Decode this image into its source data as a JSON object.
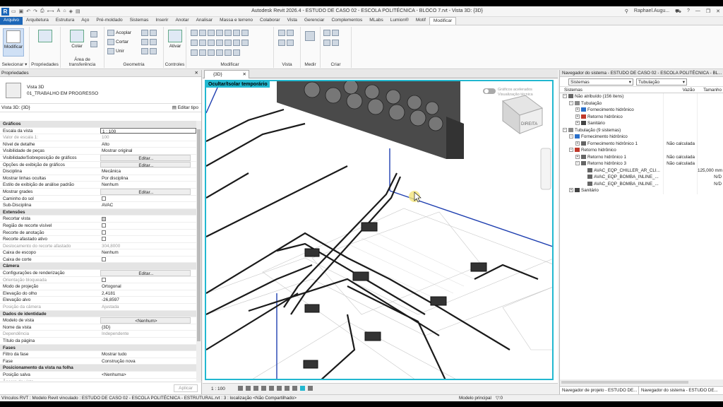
{
  "app": {
    "logo": "R",
    "window_title": "Autodesk Revit 2026.4 - ESTUDO DE CASO 02 - ESCOLA POLITÉCNICA - BLOCO 7.rvt - Vista 3D: {3D}",
    "user": "Raphael.Augu...",
    "help": "?"
  },
  "tabs": [
    "Arquivo",
    "Arquitetura",
    "Estrutura",
    "Aço",
    "Pré-moldado",
    "Sistemas",
    "Inserir",
    "Anotar",
    "Analisar",
    "Massa e terreno",
    "Colaborar",
    "Vista",
    "Gerenciar",
    "Complementos",
    "MLabs",
    "Lumion®",
    "Motif",
    "Modificar"
  ],
  "ribbon": {
    "modificar": "Modificar",
    "colar": "Colar",
    "acoplar": "Acoplar",
    "cortar": "Cortar",
    "unir": "Unir",
    "ativar": "Ativar",
    "groups": {
      "selecionar": "Selecionar ▾",
      "propriedades": "Propriedades",
      "area_transferencia": "Área de transferência",
      "geometria": "Geometria",
      "controles": "Controles",
      "modificar": "Modificar",
      "vista": "Vista",
      "medir": "Medir",
      "criar": "Criar"
    }
  },
  "properties": {
    "title": "Propriedades",
    "type_line1": "Vista 3D",
    "type_line2": "01_TRABALHO EM PROGRESSO",
    "view_selector": "Vista 3D: {3D}",
    "edit_type": "Editar tipo",
    "apply": "Aplicar",
    "rows": [
      {
        "k": "Gráficos",
        "sec": true
      },
      {
        "k": "Escala da vista",
        "v": "1 : 100",
        "input": true
      },
      {
        "k": "Valor de escala    1:",
        "v": "100",
        "dis": true
      },
      {
        "k": "Nível de detalhe",
        "v": "Alto"
      },
      {
        "k": "Visibilidade de peças",
        "v": "Mostrar original"
      },
      {
        "k": "Visibilidade/Sobreposição de gráficos",
        "v": "Editar...",
        "btn": true
      },
      {
        "k": "Opções de exibição de gráficos",
        "v": "Editar...",
        "btn": true
      },
      {
        "k": "Disciplina",
        "v": "Mecânica"
      },
      {
        "k": "Mostrar linhas ocultas",
        "v": "Por disciplina"
      },
      {
        "k": "Estilo de exibição de análise padrão",
        "v": "Nenhum"
      },
      {
        "k": "Mostrar grades",
        "v": "Editar...",
        "btn": true
      },
      {
        "k": "Caminho do sol",
        "chk": "off"
      },
      {
        "k": "Sub-Disciplina",
        "v": "AVAC"
      },
      {
        "k": "Extensões",
        "sec": true
      },
      {
        "k": "Recortar vista",
        "chk": "on"
      },
      {
        "k": "Região de recorte visível",
        "chk": "off"
      },
      {
        "k": "Recorte de anotação",
        "chk": "off"
      },
      {
        "k": "Recorte afastado ativo",
        "chk": "off"
      },
      {
        "k": "Deslocamento do recorte afastado",
        "v": "304,8000",
        "dis": true
      },
      {
        "k": "Caixa de escopo",
        "v": "Nenhum"
      },
      {
        "k": "Caixa de corte",
        "chk": "off"
      },
      {
        "k": "Câmera",
        "sec": true
      },
      {
        "k": "Configurações de renderização",
        "v": "Editar...",
        "btn": true
      },
      {
        "k": "Orientação bloqueada",
        "chk": "off",
        "dis": true
      },
      {
        "k": "Modo de projeção",
        "v": "Ortogonal"
      },
      {
        "k": "Elevação do olho",
        "v": "2,4181"
      },
      {
        "k": "Elevação alvo",
        "v": "-26,8597"
      },
      {
        "k": "Posição da câmera",
        "v": "Ajustada",
        "dis": true
      },
      {
        "k": "Dados de identidade",
        "sec": true
      },
      {
        "k": "Modelo de vista",
        "v": "<Nenhum>",
        "btn": true
      },
      {
        "k": "Nome da vista",
        "v": "{3D}"
      },
      {
        "k": "Dependência",
        "v": "Independente",
        "dis": true
      },
      {
        "k": "Título da página",
        "v": ""
      },
      {
        "k": "Fases",
        "sec": true
      },
      {
        "k": "Filtro da fase",
        "v": "Mostrar tudo"
      },
      {
        "k": "Fase",
        "v": "Construção nova"
      },
      {
        "k": "Posicionamento da vista na folha",
        "sec": true
      },
      {
        "k": "Posição salva",
        "v": "<Nenhuma>"
      },
      {
        "k": "Âncora da vista",
        "v": "",
        "dis": true
      }
    ]
  },
  "viewport": {
    "tab": "{3D}",
    "banner": "Ocultar/Isolar temporário",
    "toggle_label": "Gráficos acelerados",
    "toggle_sub": "Visualização técnica",
    "viewcube": "DIREITA",
    "scale": "1 : 100"
  },
  "system_browser": {
    "title": "Navegador do sistema - ESTUDO DE CASO 02 - ESCOLA POLITÉCNICA - BL...",
    "filter1": "Sistemas",
    "filter2": "Tubulação",
    "col1": "Sistemas",
    "col2": "Vazão",
    "col3": "Tamanho",
    "rows": [
      {
        "l": 0,
        "t": "−",
        "ic": "#666",
        "n": "Não atribuído (156 itens)",
        "v": "",
        "s": ""
      },
      {
        "l": 1,
        "t": "−",
        "ic": "#888",
        "n": "Tubulação",
        "v": "",
        "s": ""
      },
      {
        "l": 2,
        "t": "+",
        "ic": "#2a6fc9",
        "n": "Fornecimento hidrônico",
        "v": "",
        "s": ""
      },
      {
        "l": 2,
        "t": "+",
        "ic": "#c0392b",
        "n": "Retorno hidrônico",
        "v": "",
        "s": ""
      },
      {
        "l": 2,
        "t": "+",
        "ic": "#444",
        "n": "Sanitário",
        "v": "",
        "s": ""
      },
      {
        "l": 0,
        "t": "−",
        "ic": "#888",
        "n": "Tubulação (9 sistemas)",
        "v": "",
        "s": ""
      },
      {
        "l": 1,
        "t": "−",
        "ic": "#2a6fc9",
        "n": "Fornecimento hidrônico",
        "v": "",
        "s": ""
      },
      {
        "l": 2,
        "t": "+",
        "ic": "#666",
        "n": "Fornecimento hidrônico 1",
        "v": "Não calculada",
        "s": ""
      },
      {
        "l": 1,
        "t": "−",
        "ic": "#c0392b",
        "n": "Retorno hidrônico",
        "v": "",
        "s": ""
      },
      {
        "l": 2,
        "t": "+",
        "ic": "#666",
        "n": "Retorno hidrônico 1",
        "v": "Não calculada",
        "s": ""
      },
      {
        "l": 2,
        "t": "−",
        "ic": "#666",
        "n": "Retorno hidrônico 3",
        "v": "Não calculada",
        "s": ""
      },
      {
        "l": 3,
        "t": "",
        "ic": "#666",
        "n": "AVAC_EQP_CHILLER_AR_CLI...",
        "v": "",
        "s": "125,000 mm"
      },
      {
        "l": 3,
        "t": "",
        "ic": "#666",
        "n": "AVAC_EQP_BOMBA_INLINE_...",
        "v": "",
        "s": "N/D"
      },
      {
        "l": 3,
        "t": "",
        "ic": "#666",
        "n": "AVAC_EQP_BOMBA_INLINE_...",
        "v": "",
        "s": "N/D"
      },
      {
        "l": 1,
        "t": "+",
        "ic": "#444",
        "n": "Sanitário",
        "v": "",
        "s": ""
      }
    ],
    "bottom_tab1": "Navegador de projeto - ESTUDO DE...",
    "bottom_tab2": "Navegador do sistema - ESTUDO DE..."
  },
  "statusbar": {
    "left": "Vínculos RVT : Modelo Revit vinculado : ESTUDO DE CASO 02 - ESCOLA POLITÉCNICA - ESTRUTURAL.rvt : 3 : localização <Não Compartilhado>",
    "model": "Modelo principal",
    "filter_count": ":0"
  }
}
